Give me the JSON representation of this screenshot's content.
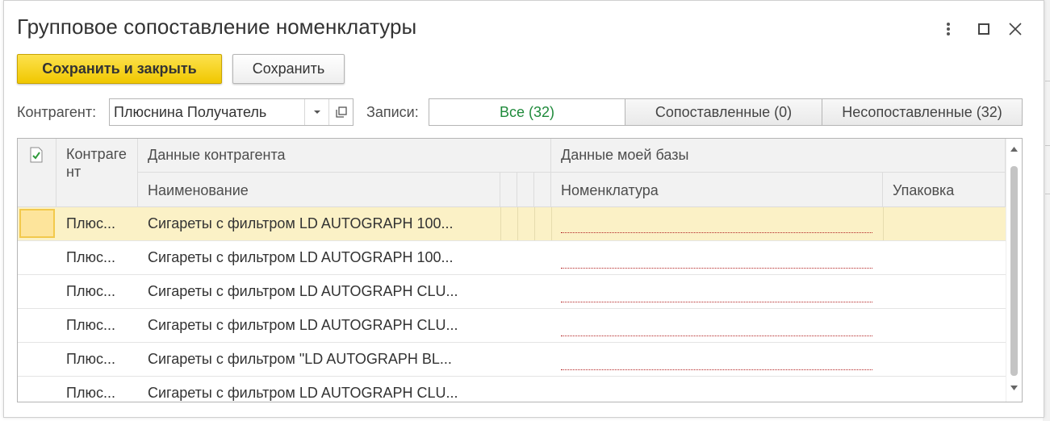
{
  "window": {
    "title": "Групповое сопоставление номенклатуры"
  },
  "toolbar": {
    "save_close_label": "Сохранить и закрыть",
    "save_label": "Сохранить"
  },
  "filter": {
    "counterparty_label": "Контрагент:",
    "counterparty_value": "Плюснина Получатель",
    "records_label": "Записи:",
    "segments": [
      {
        "label": "Все (32)",
        "active": true
      },
      {
        "label": "Сопоставленные (0)",
        "active": false
      },
      {
        "label": "Несопоставленные (32)",
        "active": false
      }
    ]
  },
  "grid": {
    "headers": {
      "counterparty": "Контрагент",
      "counterparty_data": "Данные контрагента",
      "name": "Наименование",
      "my_data": "Данные моей базы",
      "nomenclature": "Номенклатура",
      "package": "Упаковка"
    },
    "rows": [
      {
        "counterparty": "Плюс...",
        "name": "Сигареты с фильтром LD AUTOGRAPH 100...",
        "nomenclature": "",
        "package": "",
        "selected": true
      },
      {
        "counterparty": "Плюс...",
        "name": "Сигареты с фильтром LD AUTOGRAPH 100...",
        "nomenclature": "",
        "package": "",
        "selected": false
      },
      {
        "counterparty": "Плюс...",
        "name": "Сигареты с фильтром LD AUTOGRAPH CLU...",
        "nomenclature": "",
        "package": "",
        "selected": false
      },
      {
        "counterparty": "Плюс...",
        "name": "Сигареты с фильтром LD AUTOGRAPH CLU...",
        "nomenclature": "",
        "package": "",
        "selected": false
      },
      {
        "counterparty": "Плюс...",
        "name": "Сигареты с фильтром \"LD AUTOGRAPH BL...",
        "nomenclature": "",
        "package": "",
        "selected": false
      },
      {
        "counterparty": "Плюс...",
        "name": "Сигареты с фильтром LD AUTOGRAPH CLU...",
        "nomenclature": "",
        "package": "",
        "selected": false
      }
    ]
  },
  "colors": {
    "primary_button": "#f0c700",
    "active_segment_text": "#1f8a3b",
    "selected_row": "#fbf1c6",
    "required_underline": "#b22222"
  },
  "icons": {
    "menu": "more-vertical-icon",
    "maximize": "maximize-icon",
    "close": "close-icon",
    "dropdown": "chevron-down-icon",
    "open": "open-form-icon",
    "check_column": "checked-document-icon"
  }
}
